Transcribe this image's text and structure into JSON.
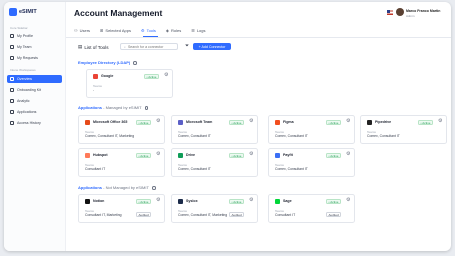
{
  "app": {
    "logo_text": "eSIMIT"
  },
  "sidebar": {
    "sections": [
      {
        "label": "Core Sidebar"
      },
      {
        "label": "Intune Workspaces"
      }
    ],
    "items": [
      {
        "label": "My Profile",
        "icon": "user-icon"
      },
      {
        "label": "My Team",
        "icon": "team-icon"
      },
      {
        "label": "My Requests",
        "icon": "inbox-icon"
      },
      {
        "label": "Overview",
        "icon": "grid-icon",
        "active": true
      },
      {
        "label": "Onboarding Kit",
        "icon": "rocket-icon"
      },
      {
        "label": "Analytic",
        "icon": "chart-icon"
      },
      {
        "label": "Applications",
        "icon": "apps-icon"
      },
      {
        "label": "Access History",
        "icon": "history-icon"
      }
    ]
  },
  "header": {
    "title": "Account Management",
    "user_name": "Marco Franco Martin",
    "user_role": "Admin"
  },
  "tabs": [
    {
      "label": "Users",
      "icon": "user-icon"
    },
    {
      "label": "Selected Apps",
      "icon": "apps-icon"
    },
    {
      "label": "Tools",
      "icon": "tools-icon",
      "active": true
    },
    {
      "label": "Roles",
      "icon": "roles-icon"
    },
    {
      "label": "Logs",
      "icon": "logs-icon"
    }
  ],
  "toolbar": {
    "list_title": "List of Tools",
    "search_placeholder": "Search for a connector",
    "add_label": "+ Add Connector"
  },
  "sections": {
    "directory": {
      "title": "Employee Directory (LDAP)"
    },
    "managed": {
      "title": "Applications",
      "sub": "- Managed by eSIMIT"
    },
    "not_managed": {
      "title": "Applications",
      "sub": "- Not Managed by eSIMIT"
    }
  },
  "status": {
    "active": "• Active",
    "audited": "Audited"
  },
  "cards": {
    "google": {
      "name": "Google",
      "label": "Teams",
      "value": "-",
      "color": "#ea4335"
    },
    "office": {
      "name": "Microsoft Office 365",
      "label": "Teams",
      "value": "Comex, Consultant IT, Marketing",
      "color": "#e64a19"
    },
    "msteam": {
      "name": "Microsoft Team",
      "label": "Teams",
      "value": "Comex, Consultant IT",
      "color": "#5b5fc7"
    },
    "figma": {
      "name": "Figma",
      "label": "Teams",
      "value": "Comex, Consultant IT",
      "color": "#f24e1e"
    },
    "pipedrive": {
      "name": "Pipedrive",
      "label": "Teams",
      "value": "Comex, Consultant IT",
      "color": "#222222"
    },
    "hubspot": {
      "name": "Hubspot",
      "label": "Teams",
      "value": "Consultant IT",
      "color": "#ff7a59"
    },
    "drive": {
      "name": "Drive",
      "label": "Teams",
      "value": "Comex, Consultant IT",
      "color": "#0f9d58"
    },
    "payfit": {
      "name": "Payfit",
      "label": "Teams",
      "value": "Comex, Consultant IT",
      "color": "#3b6ff5"
    },
    "notion": {
      "name": "Notion",
      "label": "Teams",
      "value": "Consultant IT, Marketing",
      "color": "#111111"
    },
    "syslox": {
      "name": "Syslox",
      "label": "Teams",
      "value": "Comex, Consultant IT, Marketing",
      "color": "#1c2b4a"
    },
    "sage": {
      "name": "Sage",
      "label": "Teams",
      "value": "Consultant IT",
      "color": "#00d639"
    }
  }
}
